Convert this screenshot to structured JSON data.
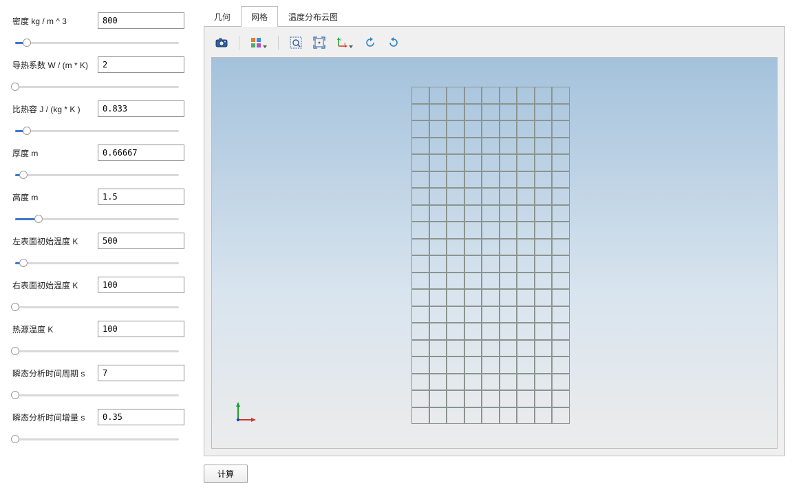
{
  "params": [
    {
      "id": "density",
      "label": "密度 kg / m ^ 3",
      "value": "800",
      "pos": 7
    },
    {
      "id": "conductivity",
      "label": "导热系数 W / (m * K)",
      "value": "2",
      "pos": 0
    },
    {
      "id": "specific-heat",
      "label": "比热容 J / (kg * K )",
      "value": "0.833",
      "pos": 7
    },
    {
      "id": "thickness",
      "label": "厚度 m",
      "value": "0.66667",
      "pos": 5
    },
    {
      "id": "height",
      "label": "高度 m",
      "value": "1.5",
      "pos": 14
    },
    {
      "id": "left-temp",
      "label": "左表面初始温度 K",
      "value": "500",
      "pos": 5
    },
    {
      "id": "right-temp",
      "label": "右表面初始温度 K",
      "value": "100",
      "pos": 0
    },
    {
      "id": "source-temp",
      "label": "热源温度  K",
      "value": "100",
      "pos": 0
    },
    {
      "id": "period",
      "label": "瞬态分析时间周期 s",
      "value": "7",
      "pos": 0
    },
    {
      "id": "increment",
      "label": "瞬态分析时间增量 s",
      "value": "0.35",
      "pos": 0
    }
  ],
  "tabs": {
    "items": [
      "几何",
      "网格",
      "温度分布云图"
    ],
    "active": 1
  },
  "toolbar_buttons": [
    {
      "id": "camera",
      "name": "camera-icon"
    },
    {
      "id": "viewmode",
      "name": "viewmode-icon",
      "dropdown": true
    },
    {
      "id": "zoom-window",
      "name": "zoom-window-icon"
    },
    {
      "id": "fit",
      "name": "fit-all-icon"
    },
    {
      "id": "axes",
      "name": "axes-icon",
      "dropdown": true
    },
    {
      "id": "rotate-ccw",
      "name": "rotate-ccw-icon"
    },
    {
      "id": "rotate-cw",
      "name": "rotate-cw-icon"
    }
  ],
  "mesh": {
    "cols": 9,
    "rows": 20
  },
  "calc_button": "计算"
}
